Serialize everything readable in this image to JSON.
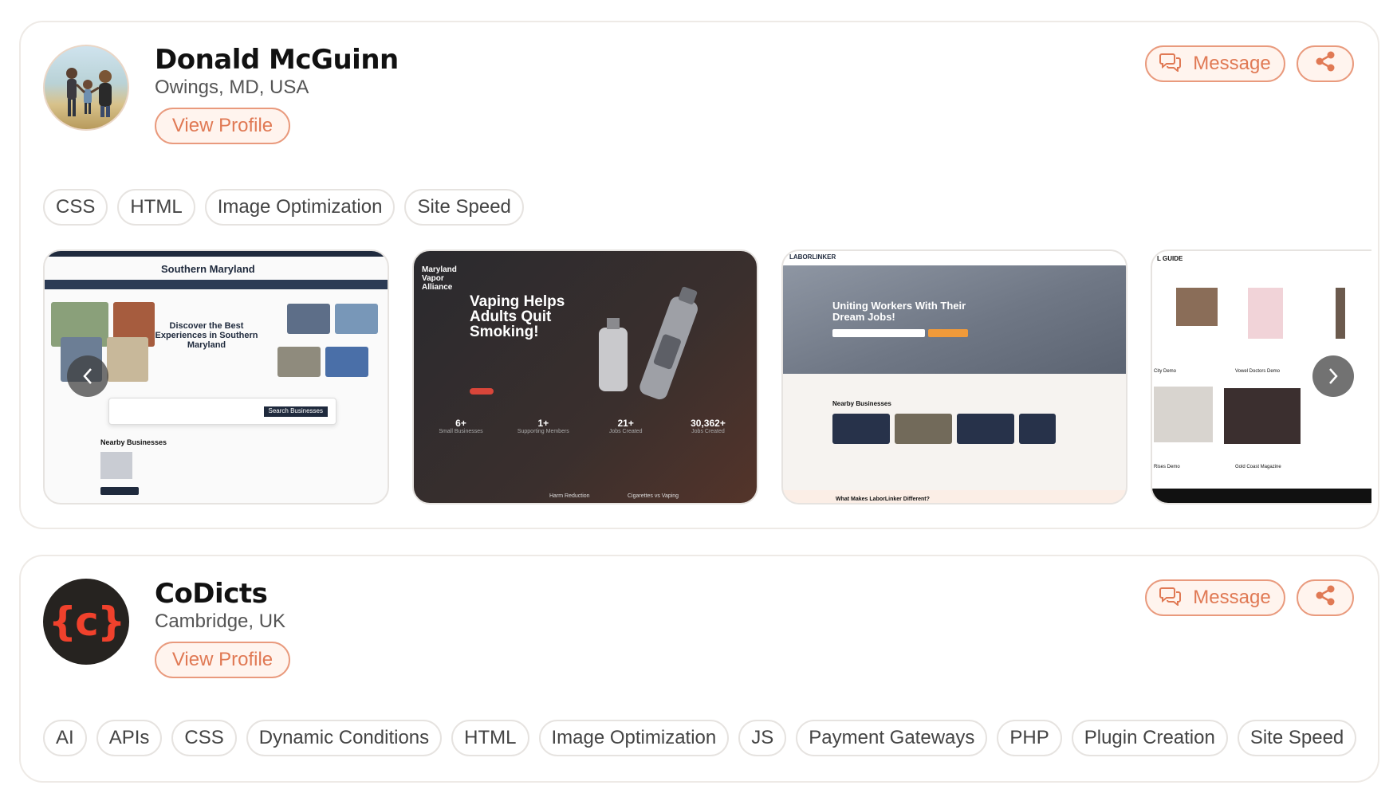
{
  "profiles": [
    {
      "name": "Donald McGuinn",
      "location": "Owings, MD, USA",
      "view_profile_label": "View Profile",
      "message_label": "Message",
      "skills": [
        "CSS",
        "HTML",
        "Image Optimization",
        "Site Speed"
      ],
      "portfolio": {
        "shot_1": {
          "logo": "Southern Maryland",
          "headline": "Discover the Best Experiences in Southern Maryland",
          "section": "Nearby Businesses",
          "button": "Search Businesses"
        },
        "shot_2": {
          "brand": "Maryland Vapor Alliance",
          "headline": "Vaping Helps Adults Quit Smoking!",
          "stats": [
            {
              "value": "6+",
              "label": "Small Businesses"
            },
            {
              "value": "1+",
              "label": "Supporting Members"
            },
            {
              "value": "21+",
              "label": "Jobs Created"
            },
            {
              "value": "30,362+",
              "label": "Jobs Created"
            }
          ],
          "footer_labels": [
            "Harm Reduction",
            "Cigarettes vs Vaping"
          ]
        },
        "shot_3": {
          "brand": "LABORLINKER",
          "headline": "Uniting Workers With Their Dream Jobs!",
          "section": "Nearby Businesses",
          "footer": "What Makes LaborLinker Different?"
        },
        "shot_4": {
          "brand": "L GUIDE",
          "items": [
            "City Demo",
            "Vowel Doctors Demo",
            "Rises Demo",
            "Gold Coast Magazine"
          ]
        }
      }
    },
    {
      "name": "CoDicts",
      "location": "Cambridge, UK",
      "view_profile_label": "View Profile",
      "message_label": "Message",
      "logo_text": "{c}",
      "skills": [
        "AI",
        "APIs",
        "CSS",
        "Dynamic Conditions",
        "HTML",
        "Image Optimization",
        "JS",
        "Payment Gateways",
        "PHP",
        "Plugin Creation",
        "Site Speed"
      ]
    }
  ],
  "colors": {
    "accent": "#e07954",
    "accent_border": "#e99a7d",
    "accent_bg": "#fff4ee",
    "tag_border": "#e6e3e0"
  },
  "icons": {
    "message": "chat-bubbles-icon",
    "share": "share-icon",
    "prev": "chevron-left-icon",
    "next": "chevron-right-icon"
  }
}
